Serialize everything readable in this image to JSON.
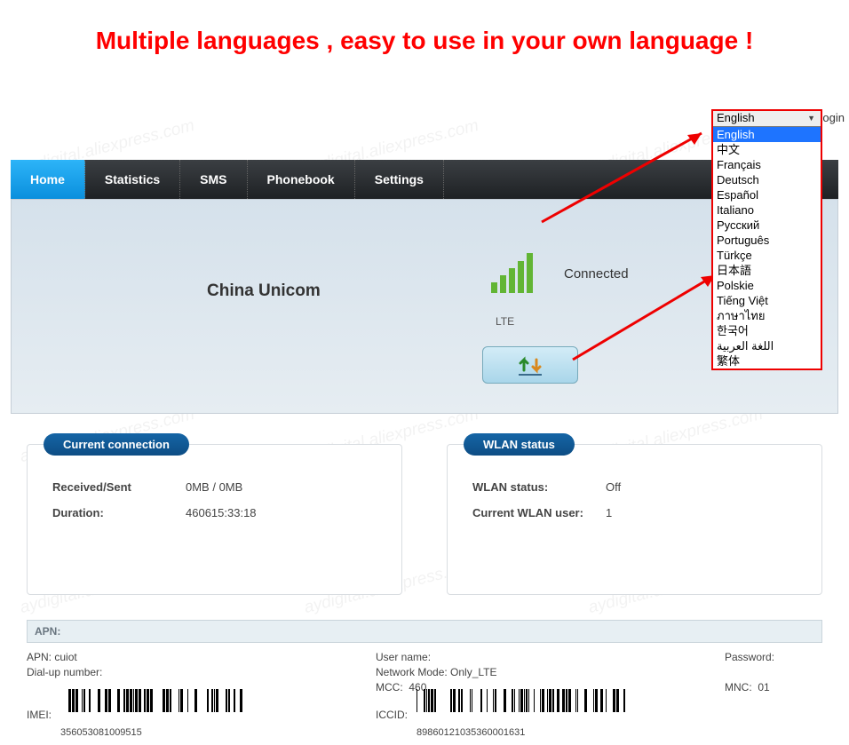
{
  "headline": "Multiple languages , easy to use in your own language !",
  "login": {
    "label": "Login"
  },
  "language": {
    "current": "English",
    "selected_index": 0,
    "options": [
      "English",
      "中文",
      "Français",
      "Deutsch",
      "Español",
      "Italiano",
      "Русский",
      "Português",
      "Türkçe",
      "日本語",
      "Polskie",
      "Tiếng Việt",
      "ภาษาไทย",
      "한국어",
      "اللغة العربية",
      "繁体"
    ]
  },
  "nav": {
    "items": [
      "Home",
      "Statistics",
      "SMS",
      "Phonebook",
      "Settings"
    ],
    "active_index": 0
  },
  "hero": {
    "carrier": "China Unicom",
    "signal_bars": 5,
    "tech_label": "LTE",
    "status": "Connected"
  },
  "panels": {
    "conn": {
      "title": "Current connection",
      "rows": [
        {
          "k": "Received/Sent",
          "v": "0MB / 0MB"
        },
        {
          "k": "Duration:",
          "v": "460615:33:18"
        }
      ]
    },
    "wlan": {
      "title": "WLAN status",
      "rows": [
        {
          "k": "WLAN status:",
          "v": "Off"
        },
        {
          "k": "Current WLAN user:",
          "v": "1"
        }
      ]
    }
  },
  "apn": {
    "header": "APN:",
    "left": {
      "apn_label": "APN:",
      "apn_value": "cuiot",
      "dial_label": "Dial-up number:",
      "dial_value": "",
      "imei_label": "IMEI:",
      "imei_value": "356053081009515"
    },
    "mid": {
      "user_label": "User name:",
      "user_value": "",
      "mode_label": "Network Mode:",
      "mode_value": "Only_LTE",
      "mcc_label": "MCC:",
      "mcc_value": "460",
      "iccid_label": "ICCID:",
      "iccid_value": "89860121035360001631"
    },
    "right": {
      "pass_label": "Password:",
      "mnc_label": "MNC:",
      "mnc_value": "01"
    }
  },
  "watermark": "aydigital.aliexpress.com"
}
